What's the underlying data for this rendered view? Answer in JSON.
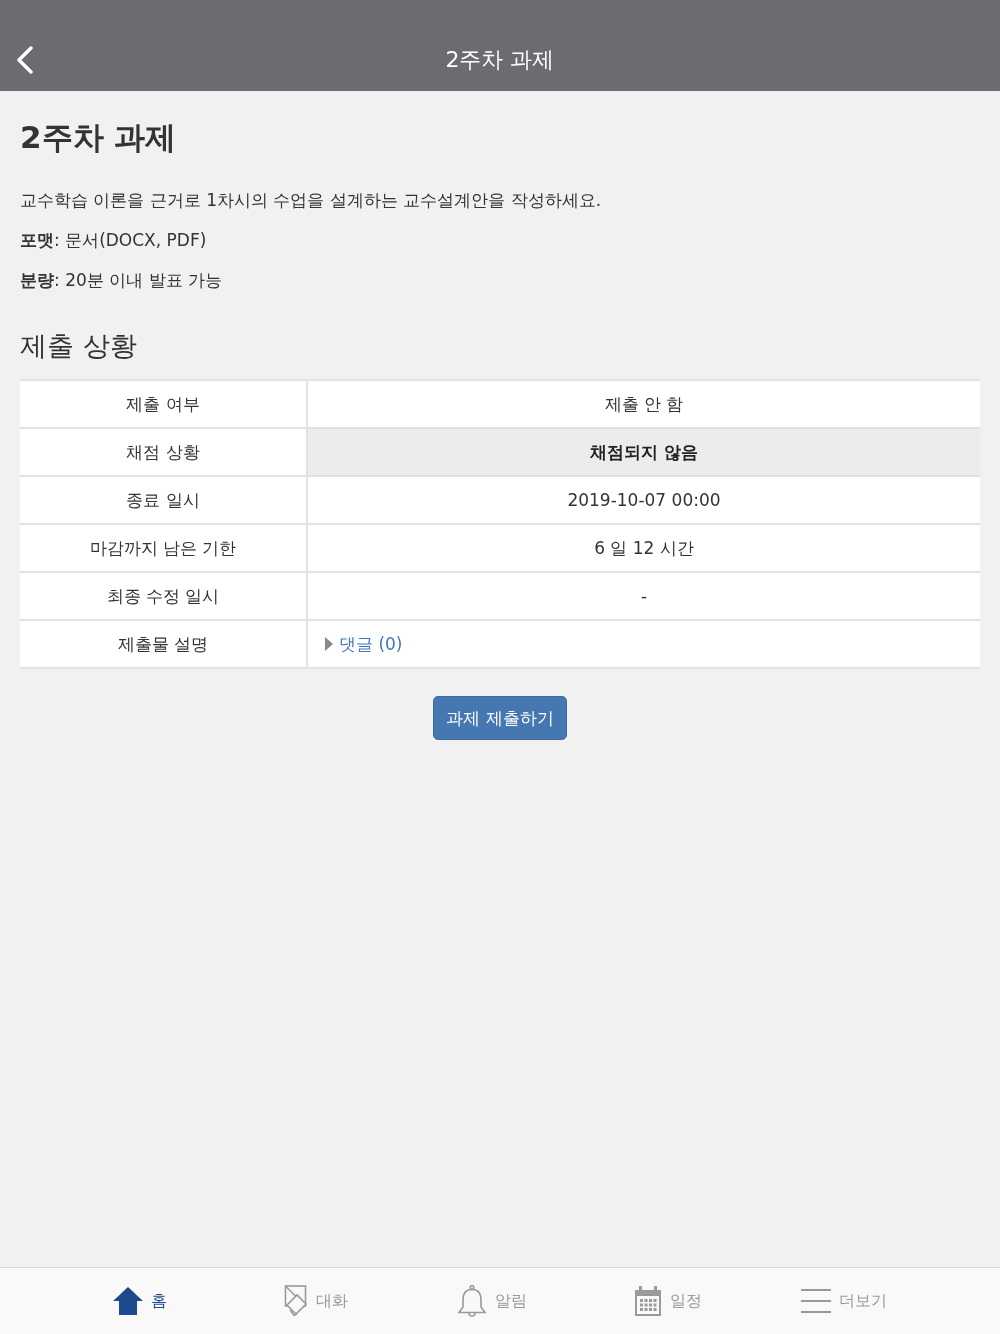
{
  "header": {
    "title": "2주차 과제"
  },
  "assignment": {
    "title": "2주차 과제",
    "description": "교수학습 이론을 근거로 1차시의 수업을 설계하는 교수설계안을 작성하세요.",
    "details": [
      "**포맷**: 문서(DOCX, PDF)",
      "**분량**: 20분 이내 발표 가능"
    ]
  },
  "submission_status": {
    "heading": "제출 상황",
    "rows": [
      {
        "label": "제출 여부",
        "value": "제출 안 함",
        "kind": "text",
        "highlighted": false
      },
      {
        "label": "채점 상황",
        "value": "채점되지 않음",
        "kind": "text",
        "highlighted": true
      },
      {
        "label": "종료 일시",
        "value": "2019-10-07 00:00",
        "kind": "text",
        "highlighted": false
      },
      {
        "label": "마감까지 남은 기한",
        "value": "6 일 12 시간",
        "kind": "text",
        "highlighted": false
      },
      {
        "label": "최종 수정 일시",
        "value": "-",
        "kind": "text",
        "highlighted": false
      },
      {
        "label": "제출물 설명",
        "value": "댓글 (0)",
        "kind": "disclosure",
        "expanded": false,
        "highlighted": false
      }
    ]
  },
  "submit_button": {
    "label": "과제 제출하기"
  },
  "tab_bar": {
    "items": [
      {
        "label": "홈",
        "selected": true
      },
      {
        "label": "대화",
        "selected": false
      },
      {
        "label": "알림",
        "selected": false
      },
      {
        "label": "일정",
        "selected": false
      },
      {
        "label": "더보기",
        "selected": false
      }
    ]
  }
}
